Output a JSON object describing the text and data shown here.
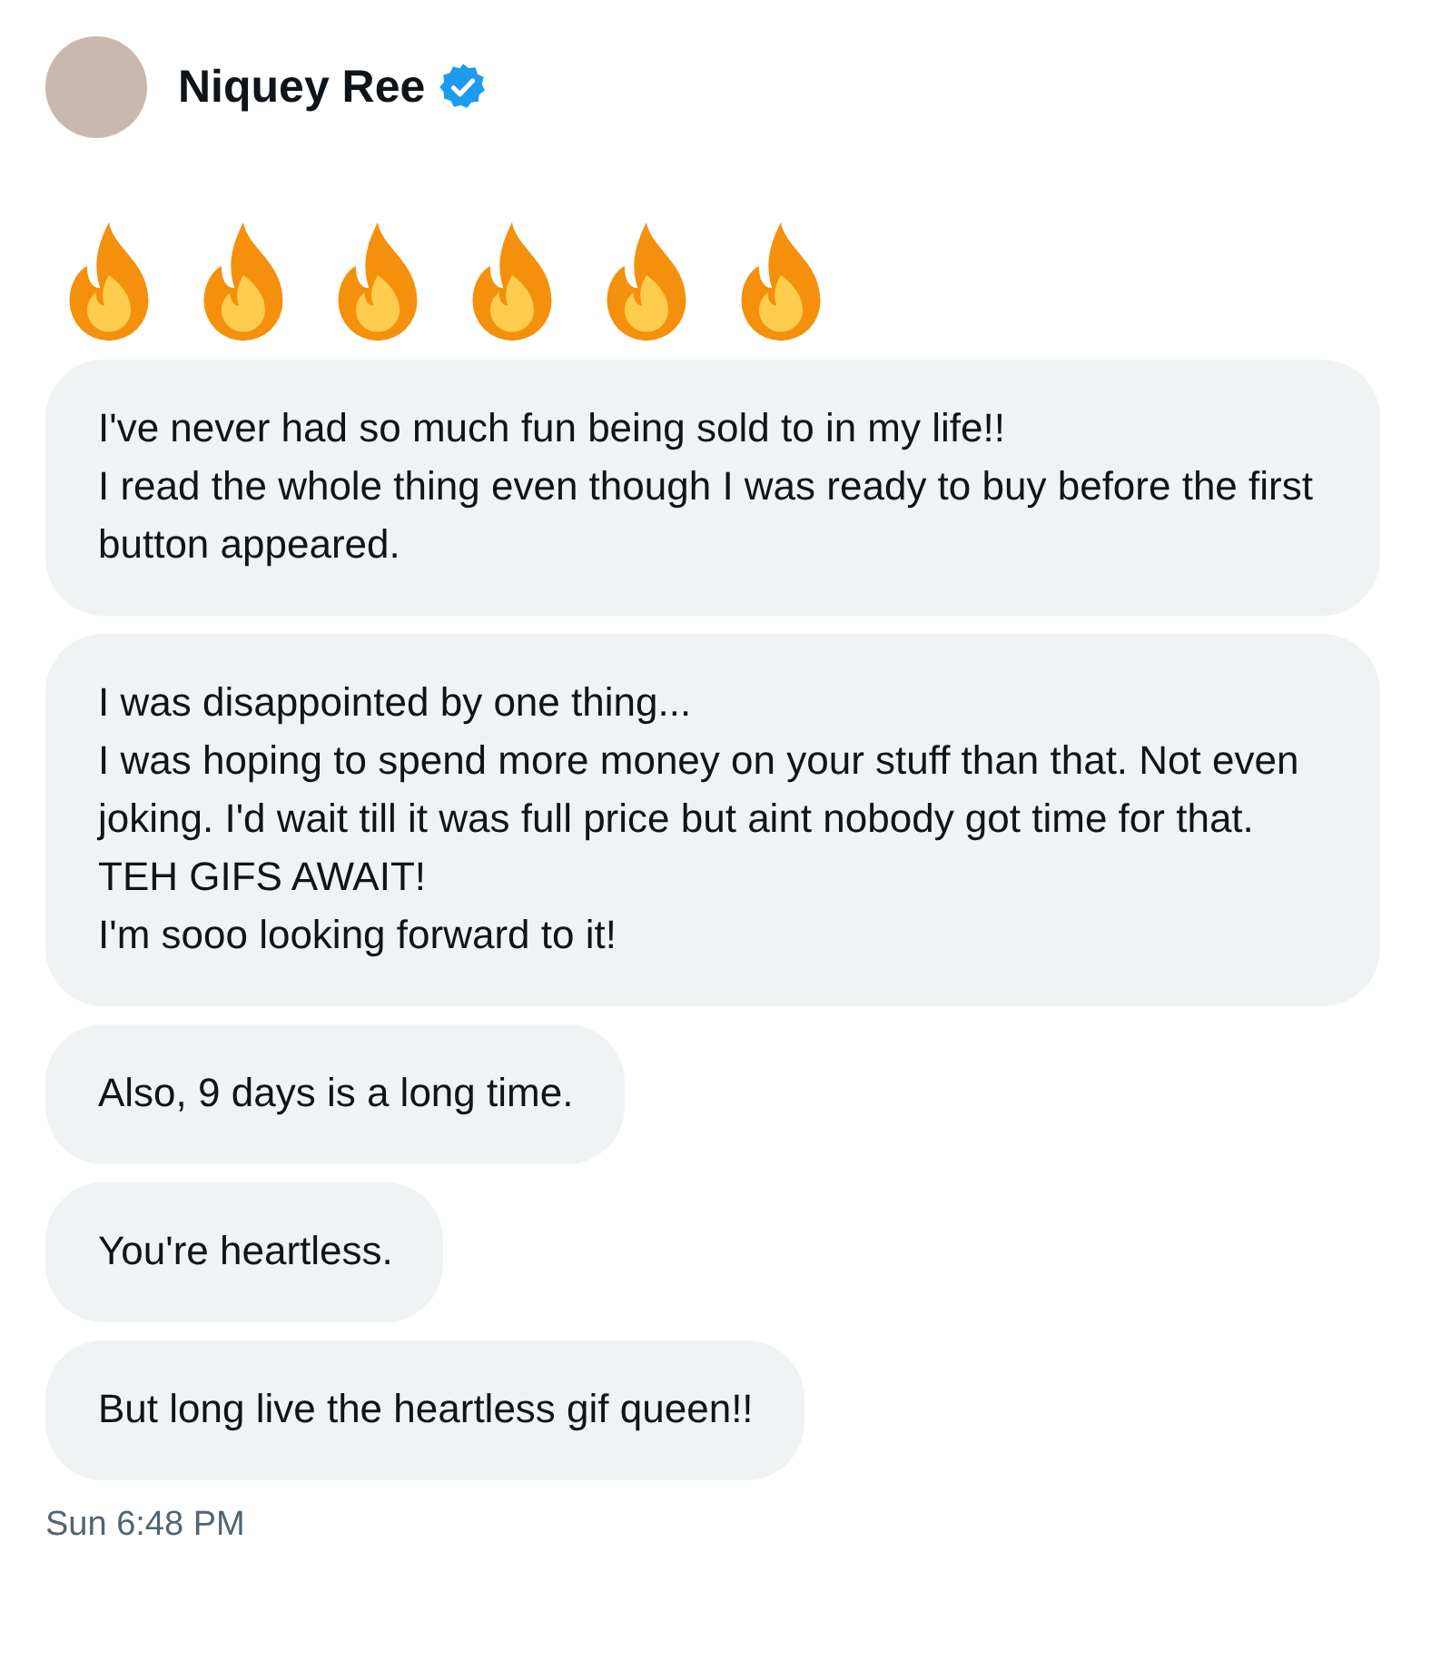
{
  "sender": {
    "name": "Niquey Ree",
    "verified": true
  },
  "messages": [
    {
      "kind": "emoji",
      "icons": [
        {
          "kind": "fire"
        },
        {
          "kind": "fire"
        },
        {
          "kind": "fire"
        },
        {
          "kind": "fire"
        },
        {
          "kind": "fire"
        },
        {
          "kind": "fire"
        }
      ]
    },
    {
      "kind": "text",
      "text": "I've never had so much fun being sold to in my life!!\nI read the whole thing even though I was ready to buy before the first button appeared."
    },
    {
      "kind": "text",
      "text": "I was disappointed by one thing...\nI was hoping to spend more money on your stuff than that. Not even joking. I'd wait till it was full price but aint nobody got time for that. TEH GIFS AWAIT!\nI'm sooo looking forward to it!"
    },
    {
      "kind": "text",
      "text": "Also, 9 days is a long time."
    },
    {
      "kind": "text",
      "text": "You're heartless."
    },
    {
      "kind": "text",
      "text": "But long live the heartless gif queen!!"
    }
  ],
  "timestamp": "Sun 6:48 PM"
}
